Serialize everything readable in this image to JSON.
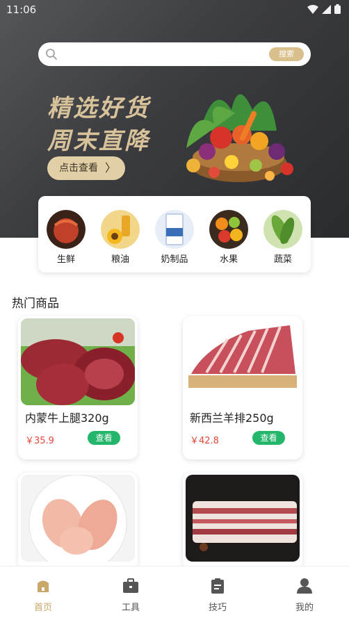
{
  "status_bar": {
    "time": "11:06"
  },
  "search": {
    "placeholder": "",
    "button_label": "搜索"
  },
  "banner": {
    "line1": "精选好货",
    "line2": "周末直降",
    "button_label": "点击查看",
    "button_arrow": "〉"
  },
  "categories": [
    {
      "label": "生鲜",
      "icon": "seafood-image"
    },
    {
      "label": "粮油",
      "icon": "oil-image"
    },
    {
      "label": "奶制品",
      "icon": "dairy-image"
    },
    {
      "label": "水果",
      "icon": "fruit-image"
    },
    {
      "label": "蔬菜",
      "icon": "vegetable-image"
    }
  ],
  "section": {
    "title": "热门商品"
  },
  "products": [
    {
      "name": "内蒙牛上腿320g",
      "price": "￥35.9",
      "action": "查看"
    },
    {
      "name": "新西兰羊排250g",
      "price": "￥42.8",
      "action": "查看"
    },
    {
      "name": "",
      "price": "",
      "action": ""
    },
    {
      "name": "",
      "price": "",
      "action": ""
    }
  ],
  "tabs": [
    {
      "label": "首页",
      "icon": "home-icon",
      "active": true
    },
    {
      "label": "工具",
      "icon": "toolbox-icon",
      "active": false
    },
    {
      "label": "技巧",
      "icon": "clipboard-icon",
      "active": false
    },
    {
      "label": "我的",
      "icon": "user-icon",
      "active": false
    }
  ],
  "colors": {
    "accent_gold": "#d9bf8c",
    "price_red": "#e8463a",
    "view_green": "#24b66a",
    "tab_active": "#c9a86a",
    "hero_dark": "#3b3c40"
  }
}
